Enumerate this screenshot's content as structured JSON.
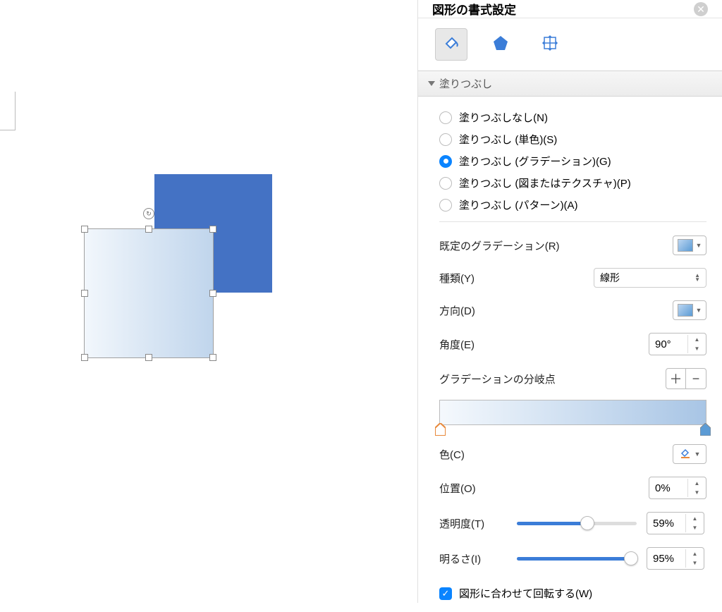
{
  "panel": {
    "title": "図形の書式設定",
    "section_fill": "塗りつぶし"
  },
  "fill_options": [
    {
      "label": "塗りつぶしなし(N)",
      "checked": false
    },
    {
      "label": "塗りつぶし (単色)(S)",
      "checked": false
    },
    {
      "label": "塗りつぶし (グラデーション)(G)",
      "checked": true
    },
    {
      "label": "塗りつぶし (図またはテクスチャ)(P)",
      "checked": false
    },
    {
      "label": "塗りつぶし (パターン)(A)",
      "checked": false
    }
  ],
  "preset_label": "既定のグラデーション(R)",
  "type_label": "種類(Y)",
  "type_value": "線形",
  "direction_label": "方向(D)",
  "angle_label": "角度(E)",
  "angle_value": "90°",
  "stops_label": "グラデーションの分岐点",
  "color_label": "色(C)",
  "position_label": "位置(O)",
  "position_value": "0%",
  "transparency_label": "透明度(T)",
  "transparency_value": "59%",
  "transparency_pct": 59,
  "brightness_label": "明るさ(I)",
  "brightness_value": "95%",
  "brightness_pct": 95,
  "rotate_with_shape_label": "図形に合わせて回転する(W)",
  "colors": {
    "accent": "#0a84ff",
    "shape_blue": "#4472c4",
    "slider_fill": "#3b7dd8"
  }
}
